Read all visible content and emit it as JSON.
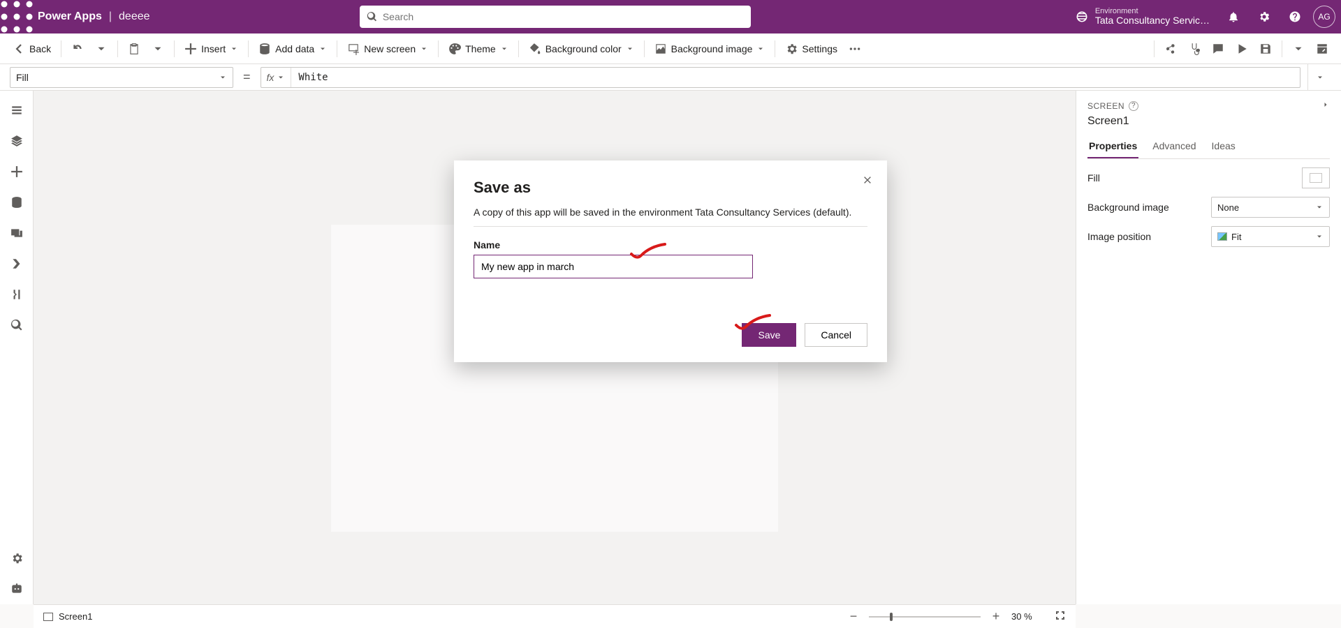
{
  "header": {
    "brand": "Power Apps",
    "separator": "|",
    "app_name": "deeee",
    "search_placeholder": "Search",
    "env_label": "Environment",
    "env_name": "Tata Consultancy Servic…",
    "avatar": "AG"
  },
  "ribbon": {
    "back": "Back",
    "insert": "Insert",
    "add_data": "Add data",
    "new_screen": "New screen",
    "theme": "Theme",
    "bg_color": "Background color",
    "bg_image": "Background image",
    "settings": "Settings"
  },
  "formula": {
    "property": "Fill",
    "equals": "=",
    "fx_label": "fx",
    "value": "White"
  },
  "right_panel": {
    "section": "SCREEN",
    "name": "Screen1",
    "tabs": {
      "properties": "Properties",
      "advanced": "Advanced",
      "ideas": "Ideas"
    },
    "props": {
      "fill_label": "Fill",
      "bg_image_label": "Background image",
      "bg_image_value": "None",
      "img_pos_label": "Image position",
      "img_pos_value": "Fit"
    }
  },
  "status": {
    "screen": "Screen1",
    "zoom_pct": "30  %"
  },
  "dialog": {
    "title": "Save as",
    "description": "A copy of this app will be saved in the environment Tata Consultancy Services (default).",
    "name_label": "Name",
    "name_value": "My new app in march",
    "save": "Save",
    "cancel": "Cancel"
  }
}
